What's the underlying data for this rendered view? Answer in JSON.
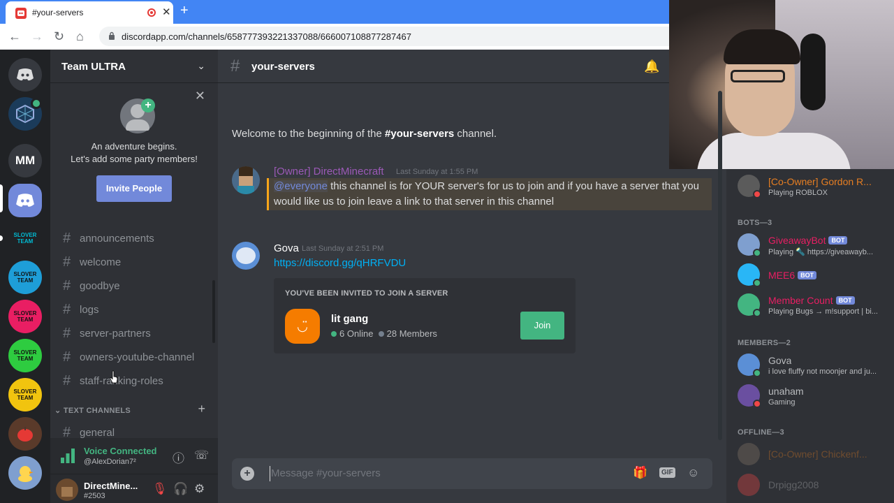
{
  "browser": {
    "tab_title": "#your-servers",
    "url": "discordapp.com/channels/658777393221337088/666007108877287467"
  },
  "rail": {
    "servers": [
      "MM",
      "SLOVER TEAM",
      "SLOVER TEAM",
      "SLOVER TEAM",
      "SLOVER TEAM",
      "SLOVER TEAM"
    ]
  },
  "sidebar": {
    "guild_name": "Team ULTRA",
    "invite": {
      "line1": "An adventure begins.",
      "line2": "Let's add some party members!",
      "button": "Invite People"
    },
    "channels": [
      "announcements",
      "welcome",
      "goodbye",
      "logs",
      "server-partners",
      "owners-youtube-channel",
      "staff-ranking-roles"
    ],
    "category": "TEXT CHANNELS",
    "general": "general",
    "voice": {
      "status": "Voice Connected",
      "server": "@AlexDorian7²"
    },
    "user": {
      "name": "DirectMine...",
      "tag": "#2503"
    }
  },
  "chat": {
    "channel": "your-servers",
    "welcome_prefix": "Welcome to the beginning of the ",
    "welcome_channel": "#your-servers",
    "welcome_suffix": " channel.",
    "messages": [
      {
        "author": "[Owner] DirectMinecraft",
        "time": "Last Sunday at 1:55 PM",
        "mention": "@everyone",
        "text": " this channel is for YOUR server's for us to join and if you have a server that you would like us to join leave a link to that server in this channel",
        "author_color": "#9b59b6"
      },
      {
        "author": "Gova",
        "time": "Last Sunday at 2:51 PM",
        "link": "https://discord.gg/qHRFVDU"
      }
    ],
    "invite_card": {
      "heading": "YOU'VE BEEN INVITED TO JOIN A SERVER",
      "guild": "lit gang",
      "online": "6 Online",
      "members": "28 Members",
      "join": "Join"
    },
    "composer_placeholder": "Message #your-servers"
  },
  "members": {
    "top": {
      "name": "[Co-Owner] Gordon R...",
      "status": "Playing ROBLOX",
      "color": "#e67e22"
    },
    "bots_header": "BOTS—3",
    "bots": [
      {
        "name": "GiveawayBot",
        "status": "Playing 🔦 https://giveawayb...",
        "badge": "BOT"
      },
      {
        "name": "MEE6",
        "status": "",
        "badge": "BOT"
      },
      {
        "name": "Member Count",
        "status": "Playing Bugs → m!support | bi...",
        "badge": "BOT"
      }
    ],
    "members_header": "MEMBERS—2",
    "list": [
      {
        "name": "Gova",
        "status": "i love fluffy not moonjer and ju..."
      },
      {
        "name": "unaham",
        "status": "Gaming"
      }
    ],
    "offline_header": "OFFLINE—3",
    "offline": [
      {
        "name": "[Co-Owner] Chickenf...",
        "color": "#e67e22"
      },
      {
        "name": "Drpigg2008",
        "color": "#8e9297"
      }
    ]
  },
  "colors": {
    "accent": "#7289da",
    "online": "#43b581",
    "dnd": "#f04747",
    "bot_name": "#e91e63"
  }
}
